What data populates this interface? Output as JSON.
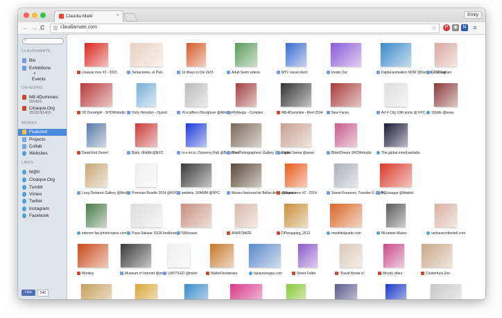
{
  "browser": {
    "tab_title": "Claudia Maté",
    "tab_close": "×",
    "user_label": "Emily",
    "url": "claudiamate.com",
    "back": "←",
    "forward": "→",
    "reload": "C",
    "star": "☆"
  },
  "sidebar": {
    "search_icon": "search-icon",
    "section_main": "CLAUDIAMATE",
    "items_main": [
      {
        "label": "Bio",
        "icon": "document-icon",
        "color": "#6f9de0"
      },
      {
        "label": "Exhibitions",
        "icon": "document-icon",
        "color": "#6f9de0"
      },
      {
        "label": "+",
        "icon": "",
        "color": ""
      },
      {
        "label": "Events",
        "icon": "",
        "color": ""
      }
    ],
    "section_ongoing": "ON-GOING",
    "items_ongoing": [
      {
        "label": "M8.4Dummies",
        "sub": "2014|15",
        "icon": "ribbon-icon",
        "color": "#c84a30"
      },
      {
        "label": "Cloaque.Org",
        "sub": "2012|13|14|15",
        "icon": "ribbon-icon",
        "color": "#c84a30"
      }
    ],
    "section_works": "WORKS",
    "items_works": [
      {
        "label": "Featured",
        "icon": "star-icon",
        "color": "#f2c230",
        "selected": true
      },
      {
        "label": "Projects",
        "icon": "folder-icon",
        "color": "#7aa9e0"
      },
      {
        "label": "Collab",
        "icon": "folder-icon",
        "color": "#7aa9e0"
      },
      {
        "label": "Websites",
        "icon": "globe-icon",
        "color": "#4aa0d8"
      }
    ],
    "section_links": "LINKS",
    "items_links": [
      {
        "label": "M@ll",
        "icon": "globe-icon",
        "color": "#4aa0d8"
      },
      {
        "label": "Cloaque.Org",
        "icon": "globe-icon",
        "color": "#4aa0d8"
      },
      {
        "label": "Tumblr",
        "icon": "globe-icon",
        "color": "#4aa0d8"
      },
      {
        "label": "Vimeo",
        "icon": "globe-icon",
        "color": "#4aa0d8"
      },
      {
        "label": "Twitter",
        "icon": "globe-icon",
        "color": "#4aa0d8"
      },
      {
        "label": "Instagram",
        "icon": "globe-icon",
        "color": "#4aa0d8"
      },
      {
        "label": "Facebook",
        "icon": "globe-icon",
        "color": "#4aa0d8"
      }
    ],
    "like_label": "Like",
    "like_count": "946"
  },
  "grid": [
    [
      {
        "caption": "cloaque.mov #3 - 2015",
        "color": "#d8261e",
        "icon": "ribbon-icon"
      },
      {
        "caption": "Tentaciones, el País",
        "color": "#e8d0c0",
        "icon": "document-icon"
      },
      {
        "caption": "1k Ways to Die 2k15",
        "color": "#d65a2a",
        "icon": "document-icon"
      },
      {
        "caption": "Adult Swim videos",
        "color": "#5a9a5a",
        "icon": "document-icon"
      },
      {
        "caption": "MTV visual ident",
        "color": "#3a6ad0",
        "icon": "document-icon"
      },
      {
        "caption": "Inside Out",
        "color": "#8a5ad8",
        "icon": "document-icon"
      },
      {
        "caption": "Digital animation NOW @Denver, Colorado",
        "color": "#3a8ac8",
        "icon": "document-icon"
      },
      {
        "caption": "GUCCI-gram",
        "color": "#d8a8a0",
        "icon": "document-icon"
      }
    ],
    [
      {
        "caption": "3D Dreamgirl - SHOWstudio",
        "color": "#b83a3a",
        "icon": "ribbon-icon"
      },
      {
        "caption": "Holly Herndon - Ouzed",
        "color": "#7ab0d8",
        "icon": "document-icon"
      },
      {
        "caption": "#LocalNon #Sculpture @Athens",
        "color": "#bbbbbb",
        "icon": "document-icon"
      },
      {
        "caption": "FKAtwigs - Complex",
        "color": "#a04040",
        "icon": "document-icon"
      },
      {
        "caption": "M8.4Dummies - Reel 2014",
        "color": "#333333",
        "icon": "ribbon-icon"
      },
      {
        "caption": "New Faces",
        "color": "#a83a3a",
        "icon": "document-icon"
      },
      {
        "caption": "Art F City 10th anniv @ NYC",
        "color": "#dddddd",
        "icon": "document-icon"
      },
      {
        "caption": "15fdds @www",
        "color": "#8a3a3a",
        "icon": "globe-icon"
      }
    ],
    [
      {
        "caption": "Dead End Desert",
        "color": "#5a7aa8",
        "icon": "ribbon-icon"
      },
      {
        "caption": "Bjork, MoMA @NYC",
        "color": "#c83a3a",
        "icon": "document-icon"
      },
      {
        "caption": "ni-s-im.in, Dissenny Hub @Barcelona",
        "color": "#1a3ad8",
        "icon": "document-icon"
      },
      {
        "caption": "The Photographers' Gallery @London",
        "color": "#7a6a5a",
        "icon": "document-icon"
      },
      {
        "caption": "Digital Sweat @www",
        "color": "#c8a090",
        "icon": "document-icon"
      },
      {
        "caption": "Blink/Dream SHOWstudio",
        "color": "#c85a8a",
        "icon": "document-icon"
      },
      {
        "caption": "The.global.mood.website",
        "color": "#1a1a3a",
        "icon": "globe-icon"
      }
    ],
    [
      {
        "caption": "Long Distance Gallery @Berlin",
        "color": "#c8a878",
        "icon": "document-icon"
      },
      {
        "caption": "Premium Bundle 2014 @NYC",
        "color": "#eeeeee",
        "icon": "document-icon"
      },
      {
        "caption": "webfets, SPAMM @NYC",
        "color": "#3a3a3a",
        "icon": "document-icon"
      },
      {
        "caption": "Museo Nacional de Bellas Artes @Buenos Aires",
        "color": "#5a4a3a",
        "icon": "document-icon"
      },
      {
        "caption": "cloaque.mov #2 - 2014",
        "color": "#e85a1a",
        "icon": "ribbon-icon"
      },
      {
        "caption": "Sweet Finances, Transfer G @NYC",
        "color": "#aab0b8",
        "icon": "document-icon"
      },
      {
        "caption": "illy.cloaque @Madrid",
        "color": "#d83a2a",
        "icon": "document-icon"
      }
    ],
    [
      {
        "caption": "internet-fax-photocopies.com",
        "color": "#4a7a4a",
        "icon": "globe-icon"
      },
      {
        "caption": "Pepa Salazar SS16 lookbook",
        "color": "#dddddd",
        "icon": "document-icon"
      },
      {
        "caption": "NKtissues",
        "color": "#c89080",
        "icon": "document-icon"
      },
      {
        "caption": "ANATOMIZE",
        "color": "#d8b8a8",
        "icon": "ribbon-icon"
      },
      {
        "caption": "DPwrapping_2013",
        "color": "#c8903a",
        "icon": "ribbon-icon"
      },
      {
        "caption": "madridelgrade.com",
        "color": "#d8682a",
        "icon": "globe-icon"
      },
      {
        "caption": "Mountain Mazes",
        "color": "#5a5a5a",
        "icon": "globe-icon"
      },
      {
        "caption": "venturacortbonell.com",
        "color": "#d8b0a0",
        "icon": "globe-icon"
      }
    ],
    [
      {
        "caption": "Monkey",
        "color": "#c84a1a",
        "icon": "ribbon-icon"
      },
      {
        "caption": "Museum of Internet @www",
        "color": "#3a3a3a",
        "icon": "document-icon"
      },
      {
        "caption": "UNTITLED @mishi",
        "color": "#eeeeee",
        "icon": "document-icon"
      },
      {
        "caption": "WallerDesbaraes",
        "color": "#c8782a",
        "icon": "ribbon-icon"
      },
      {
        "caption": "bylaurenegas.com",
        "color": "#5a8ac8",
        "icon": "globe-icon"
      },
      {
        "caption": "Street Falter",
        "color": "#8a5ac8",
        "icon": "ribbon-icon"
      },
      {
        "caption": "\"David Bowie is\"",
        "color": "#d8c8b8",
        "icon": "ribbon-icon"
      },
      {
        "caption": "Moody vibes",
        "color": "#c84a8a",
        "icon": "ribbon-icon"
      },
      {
        "caption": "Clusterfuck Zoo",
        "color": "#c8a88a",
        "icon": "ribbon-icon"
      }
    ],
    [
      {
        "caption": "",
        "color": "#c8a060",
        "icon": ""
      },
      {
        "caption": "",
        "color": "#d8a83a",
        "icon": ""
      },
      {
        "caption": "",
        "color": "#3a8ac8",
        "icon": ""
      },
      {
        "caption": "",
        "color": "#d83a8a",
        "icon": ""
      },
      {
        "caption": "",
        "color": "#8ac83a",
        "icon": ""
      },
      {
        "caption": "",
        "color": "#5a5a8a",
        "icon": ""
      },
      {
        "caption": "",
        "color": "#1a3ac8",
        "icon": ""
      },
      {
        "caption": "",
        "color": "#c8c8c8",
        "icon": ""
      }
    ]
  ]
}
